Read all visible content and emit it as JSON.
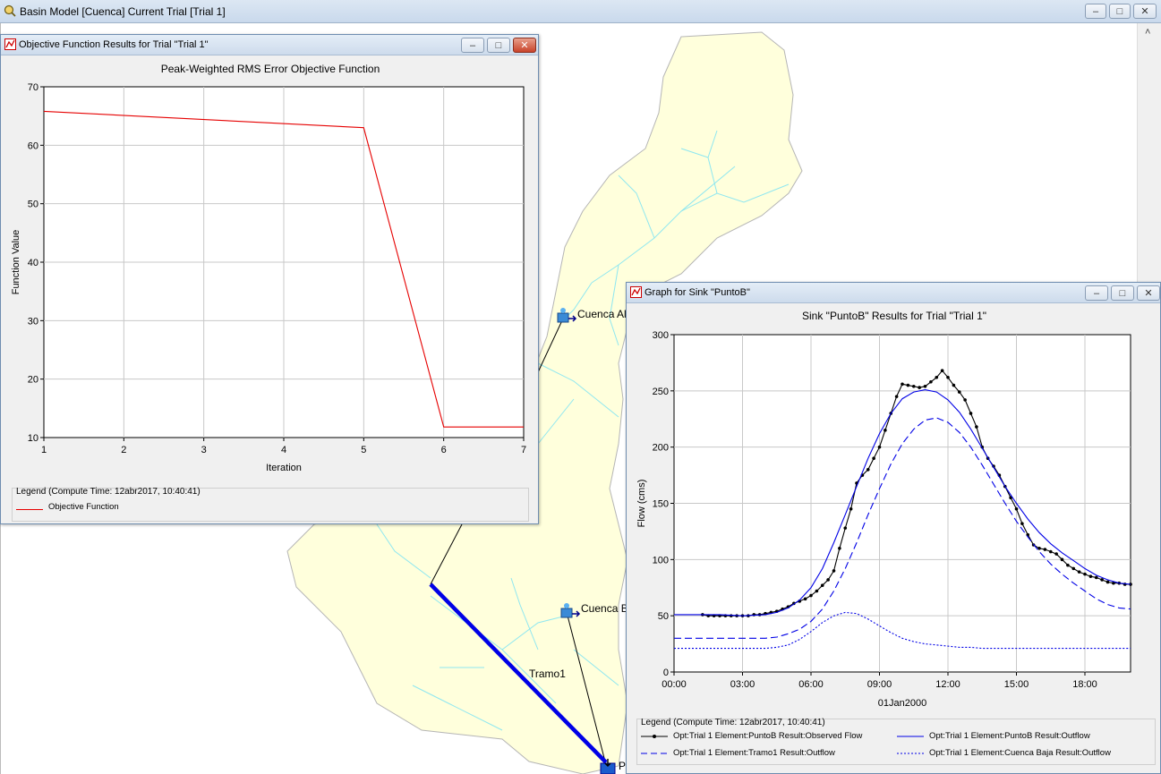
{
  "main_window": {
    "title": "Basin Model [Cuenca] Current Trial [Trial 1]",
    "scroll_up_glyph": "˄"
  },
  "map": {
    "labels": [
      "Cuenca Alt",
      "Cuenca B",
      "Tramo1",
      "P"
    ],
    "colors": {
      "basin_fill": "#ffffdc",
      "basin_border": "#b7b7b7",
      "streams": "#8fe7f0",
      "reach": "#0000e6"
    }
  },
  "objective_window": {
    "title": "Objective Function Results for Trial \"Trial 1\"",
    "chart_title": "Peak-Weighted RMS Error Objective Function",
    "legend_header": "Legend (Compute Time: 12abr2017, 10:40:41)",
    "legend_item": "Objective Function"
  },
  "sink_window": {
    "title": "Graph for Sink \"PuntoB\"",
    "chart_title": "Sink \"PuntoB\" Results for Trial \"Trial 1\"",
    "legend_header": "Legend (Compute Time: 12abr2017, 10:40:41)",
    "legend_items": [
      "Opt:Trial 1 Element:PuntoB Result:Observed Flow",
      "Opt:Trial 1 Element:PuntoB Result:Outflow",
      "Opt:Trial 1 Element:Tramo1 Result:Outflow",
      "Opt:Trial 1 Element:Cuenca Baja Result:Outflow"
    ]
  },
  "chart_data": [
    {
      "type": "line",
      "title": "Peak-Weighted RMS Error Objective Function",
      "xlabel": "Iteration",
      "ylabel": "Function Value",
      "xlim": [
        1,
        7
      ],
      "ylim": [
        10,
        70
      ],
      "xticks": [
        "1",
        "2",
        "3",
        "4",
        "5",
        "6",
        "7"
      ],
      "yticks": [
        "10",
        "20",
        "30",
        "40",
        "50",
        "60",
        "70"
      ],
      "grid": true,
      "series": [
        {
          "name": "Objective Function",
          "color": "#e60000",
          "x": [
            1,
            5,
            6,
            7
          ],
          "y": [
            65.8,
            63.0,
            11.8,
            11.8
          ]
        }
      ]
    },
    {
      "type": "line",
      "title": "Sink \"PuntoB\" Results for Trial \"Trial 1\"",
      "xlabel": "01Jan2000",
      "ylabel": "Flow (cms)",
      "xlim": [
        0,
        20
      ],
      "ylim": [
        0,
        300
      ],
      "xticks": [
        "00:00",
        "03:00",
        "06:00",
        "09:00",
        "12:00",
        "15:00",
        "18:00"
      ],
      "yticks": [
        "0",
        "50",
        "100",
        "150",
        "200",
        "250",
        "300"
      ],
      "grid": true,
      "series": [
        {
          "name": "Opt:Trial 1 Element:PuntoB Result:Observed Flow",
          "color": "#000000",
          "style": "solid-markers",
          "x": [
            1.25,
            1.5,
            1.75,
            2.0,
            2.25,
            2.5,
            2.75,
            3.0,
            3.25,
            3.5,
            3.75,
            4.0,
            4.25,
            4.5,
            4.75,
            5.0,
            5.25,
            5.5,
            5.75,
            6.0,
            6.25,
            6.5,
            6.75,
            7.0,
            7.25,
            7.5,
            7.75,
            8.0,
            8.25,
            8.5,
            8.75,
            9.0,
            9.25,
            9.5,
            9.75,
            10.0,
            10.25,
            10.5,
            10.75,
            11.0,
            11.25,
            11.5,
            11.75,
            12.0,
            12.25,
            12.5,
            12.75,
            13.0,
            13.25,
            13.5,
            13.75,
            14.0,
            14.25,
            14.5,
            14.75,
            15.0,
            15.25,
            15.5,
            15.75,
            16.0,
            16.25,
            16.5,
            16.75,
            17.0,
            17.25,
            17.5,
            17.75,
            18.0,
            18.25,
            18.5,
            18.75,
            19.0,
            19.25,
            19.5,
            19.75,
            20.0
          ],
          "y": [
            51,
            50,
            50,
            50,
            50,
            50,
            50,
            50,
            50,
            51,
            51,
            52,
            53,
            54,
            56,
            58,
            61,
            63,
            65,
            68,
            72,
            77,
            82,
            90,
            110,
            128,
            145,
            168,
            175,
            180,
            190,
            200,
            215,
            230,
            245,
            256,
            255,
            254,
            253,
            254,
            258,
            262,
            268,
            262,
            255,
            249,
            242,
            230,
            218,
            200,
            190,
            183,
            175,
            165,
            155,
            145,
            132,
            122,
            113,
            110,
            109,
            107,
            105,
            100,
            95,
            92,
            89,
            87,
            85,
            84,
            82,
            80,
            79,
            79,
            78,
            78
          ]
        },
        {
          "name": "Opt:Trial 1 Element:PuntoB Result:Outflow",
          "color": "#0000e6",
          "style": "solid",
          "x": [
            0,
            1,
            2,
            3,
            4,
            4.5,
            5,
            5.5,
            6,
            6.5,
            7,
            7.5,
            8,
            8.5,
            9,
            9.5,
            10,
            10.5,
            11,
            11.5,
            12,
            12.5,
            13,
            13.5,
            14,
            14.5,
            15,
            15.5,
            16,
            16.5,
            17,
            17.5,
            18,
            18.5,
            19,
            19.5,
            20
          ],
          "y": [
            51,
            51,
            51,
            50,
            51,
            53,
            57,
            64,
            75,
            92,
            115,
            140,
            165,
            190,
            212,
            230,
            243,
            249,
            251,
            249,
            242,
            231,
            216,
            199,
            182,
            165,
            150,
            136,
            124,
            114,
            106,
            99,
            92,
            86,
            82,
            79,
            78
          ]
        },
        {
          "name": "Opt:Trial 1 Element:Tramo1 Result:Outflow",
          "color": "#0000e6",
          "style": "dashed",
          "x": [
            0,
            1,
            2,
            3,
            4,
            4.5,
            5,
            5.5,
            6,
            6.5,
            7,
            7.5,
            8,
            8.5,
            9,
            9.5,
            10,
            10.5,
            11,
            11.5,
            12,
            12.5,
            13,
            13.5,
            14,
            14.5,
            15,
            15.5,
            16,
            16.5,
            17,
            17.5,
            18,
            18.5,
            19,
            19.5,
            20
          ],
          "y": [
            30,
            30,
            30,
            30,
            30,
            31,
            34,
            38,
            45,
            56,
            72,
            92,
            115,
            140,
            163,
            185,
            203,
            216,
            224,
            226,
            222,
            213,
            200,
            184,
            167,
            150,
            134,
            120,
            107,
            96,
            87,
            79,
            72,
            65,
            60,
            57,
            56
          ]
        },
        {
          "name": "Opt:Trial 1 Element:Cuenca Baja Result:Outflow",
          "color": "#0000e6",
          "style": "dotted",
          "x": [
            0,
            1,
            2,
            3,
            4,
            4.5,
            5,
            5.5,
            6,
            6.5,
            7,
            7.5,
            8,
            8.5,
            9,
            9.5,
            10,
            10.5,
            11,
            11.5,
            12,
            12.5,
            13,
            13.5,
            14,
            14.5,
            15,
            15.5,
            16,
            16.5,
            17,
            17.5,
            18,
            18.5,
            19,
            19.5,
            20
          ],
          "y": [
            21,
            21,
            21,
            21,
            21,
            22,
            24,
            29,
            36,
            44,
            50,
            53,
            52,
            47,
            41,
            35,
            30,
            27,
            25,
            24,
            23,
            22,
            22,
            21,
            21,
            21,
            21,
            21,
            21,
            21,
            21,
            21,
            21,
            21,
            21,
            21,
            21
          ]
        }
      ]
    }
  ]
}
